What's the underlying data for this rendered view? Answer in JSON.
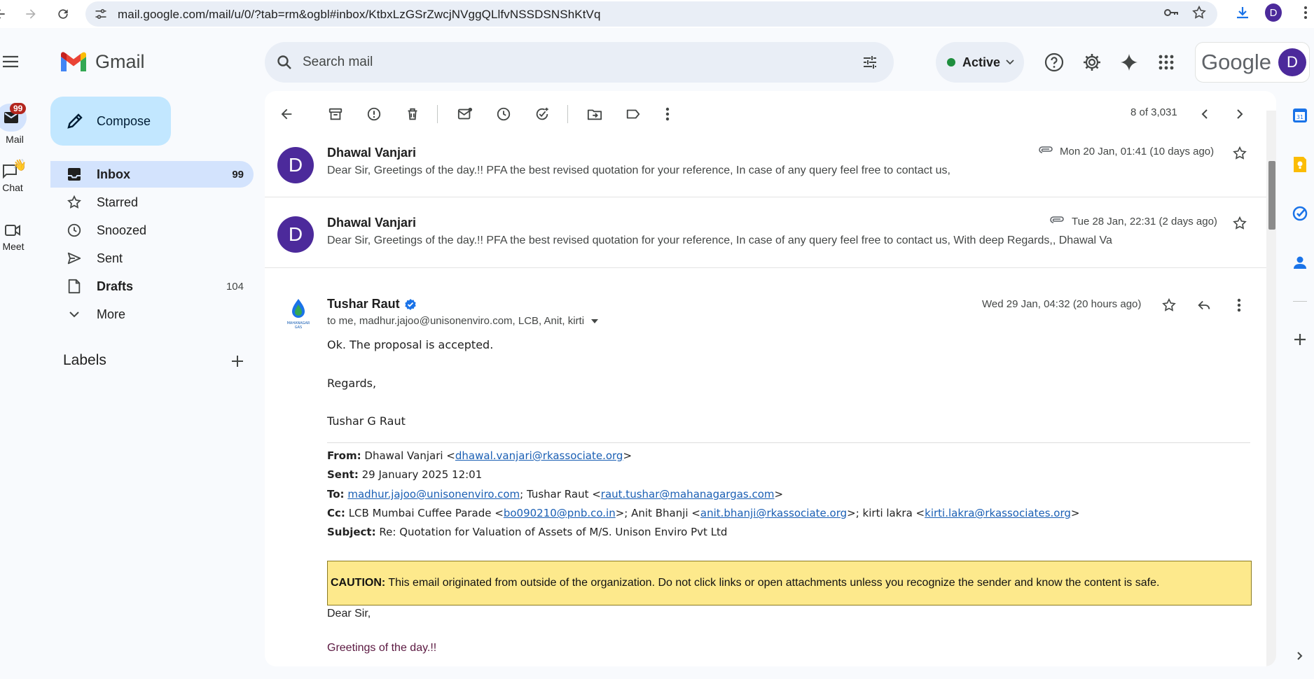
{
  "browser": {
    "url": "mail.google.com/mail/u/0/?tab=rm&ogbl#inbox/KtbxLzGSrZwcjNVggQLlfvNSSDSNShKtVq",
    "profile_initial": "D"
  },
  "rail": {
    "mail_label": "Mail",
    "mail_badge": "99",
    "chat_label": "Chat",
    "meet_label": "Meet"
  },
  "header": {
    "app_name": "Gmail",
    "search_placeholder": "Search mail",
    "status_label": "Active",
    "google_word": "Google",
    "avatar_initial": "D"
  },
  "nav": {
    "compose_label": "Compose",
    "items": [
      {
        "label": "Inbox",
        "count": "99",
        "icon": "inbox-icon"
      },
      {
        "label": "Starred",
        "count": "",
        "icon": "star-icon"
      },
      {
        "label": "Snoozed",
        "count": "",
        "icon": "clock-icon"
      },
      {
        "label": "Sent",
        "count": "",
        "icon": "send-icon"
      },
      {
        "label": "Drafts",
        "count": "104",
        "icon": "draft-icon"
      },
      {
        "label": "More",
        "count": "",
        "icon": "chevron-down-icon"
      }
    ],
    "labels_title": "Labels"
  },
  "toolbar": {
    "page_count": "8 of 3,031"
  },
  "messages": [
    {
      "sender": "Dhawal Vanjari",
      "initial": "D",
      "date": "Mon 20 Jan, 01:41 (10 days ago)",
      "snippet": "Dear Sir, Greetings of the day.!! PFA the best revised quotation for your reference, In case of any query feel free to contact us,"
    },
    {
      "sender": "Dhawal Vanjari",
      "initial": "D",
      "date": "Tue 28 Jan, 22:31 (2 days ago)",
      "snippet": "Dear Sir, Greetings of the day.!! PFA the best revised quotation for your reference, In case of any query feel free to contact us, With deep Regards,, Dhawal Va"
    }
  ],
  "open_message": {
    "sender": "Tushar Raut",
    "date": "Wed 29 Jan, 04:32 (20 hours ago)",
    "to_line": "to me, madhur.jajoo@unisonenviro.com, LCB, Anit, kirti",
    "logo_text": "MAHANAGAR GAS",
    "body_lines": [
      "Ok. The proposal is accepted.",
      "Regards,",
      "Tushar G Raut"
    ],
    "quoted": {
      "from_label": "From:",
      "from_name": "Dhawal Vanjari <",
      "from_email": "dhawal.vanjari@rkassociate.org",
      "from_close": ">",
      "sent_label": "Sent:",
      "sent_value": "29 January 2025 12:01",
      "to_label": "To:",
      "to_email1": "madhur.jajoo@unisonenviro.com",
      "to_mid": "; Tushar Raut <",
      "to_email2": "raut.tushar@mahanagargas.com",
      "to_close": ">",
      "cc_label": "Cc:",
      "cc_name1": "LCB Mumbai Cuffee Parade <",
      "cc_email1": "bo090210@pnb.co.in",
      "cc_mid1": ">; Anit Bhanji <",
      "cc_email2": "anit.bhanji@rkassociate.org",
      "cc_mid2": ">; kirti lakra <",
      "cc_email3": "kirti.lakra@rkassociates.org",
      "cc_close": ">",
      "subject_label": "Subject:",
      "subject_value": "Re: Quotation for Valuation of Assets of M/S. Unison Enviro Pvt Ltd"
    },
    "caution_label": "CAUTION:",
    "caution_text": " This email originated from outside of the organization. Do not click links or open attachments unless you recognize the sender and know the content is safe.",
    "greeting": "Dear Sir,",
    "greeting2": "Greetings of the day.!!"
  },
  "colors": {
    "compose_bg": "#c2e7ff",
    "active_nav_bg": "#d3e3fd",
    "badge": "#b3261e",
    "avatar": "#4c2a9b",
    "caution_bg": "#fde98c"
  }
}
